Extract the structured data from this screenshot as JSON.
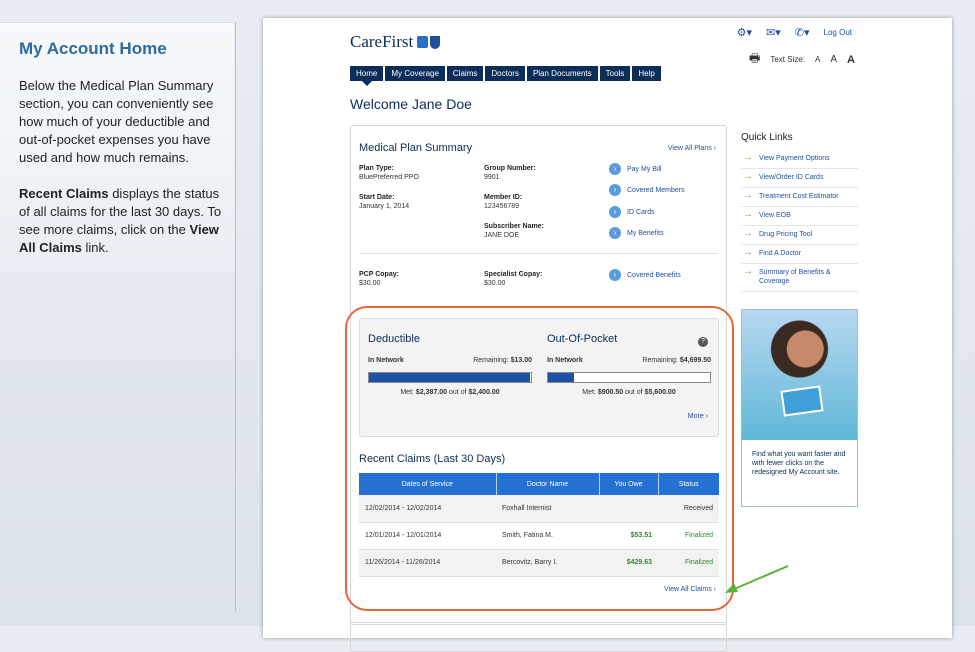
{
  "sidebar": {
    "title": "My Account Home",
    "para1": "Below the Medical Plan Summary section, you can conveniently see how much of your deductible and out-of-pocket expenses you have used and how much remains.",
    "para2_bold": "Recent Claims",
    "para2_a": " displays the status of all claims for the last 30 days. To see more claims, click on the ",
    "para2_bold2": "View All Claims",
    "para2_b": " link."
  },
  "header": {
    "logo": "CareFirst",
    "logout": "Log Out",
    "text_size_label": "Text Size:",
    "text_sizes": [
      "A",
      "A",
      "A"
    ]
  },
  "nav": [
    "Home",
    "My Coverage",
    "Claims",
    "Doctors",
    "Plan Documents",
    "Tools",
    "Help"
  ],
  "welcome": "Welcome  Jane Doe",
  "summary": {
    "title": "Medical Plan Summary",
    "view_all_plans": "View All Plans",
    "plan_type_label": "Plan Type:",
    "plan_type": "BluePreferred PPO",
    "group_label": "Group Number:",
    "group": "9901",
    "start_label": "Start Date:",
    "start": "January 1, 2014",
    "member_label": "Member ID:",
    "member": "123456789",
    "subscriber_label": "Subscriber Name:",
    "subscriber": "JANE DOE",
    "pcp_label": "PCP Copay:",
    "pcp": "$30.00",
    "specialist_label": "Specialist Copay:",
    "specialist": "$30.00",
    "links": [
      "Pay My Bill",
      "Covered Members",
      "ID Cards",
      "My Benefits",
      "Covered Benefits"
    ]
  },
  "costs": {
    "deductible_title": "Deductible",
    "oop_title": "Out-Of-Pocket",
    "in_network": "In Network",
    "ded_remaining_label": "Remaining:",
    "ded_remaining": "$13.00",
    "oop_remaining_label": "Remaining:",
    "oop_remaining": "$4,699.50",
    "ded_met_label": "Met:",
    "ded_met": "$2,387.00",
    "ded_out_of": "out of",
    "ded_total": "$2,400.00",
    "oop_met_label": "Met:",
    "oop_met": "$900.50",
    "oop_out_of": "out of",
    "oop_total": "$5,600.00",
    "ded_fill_pct": 99.5,
    "oop_fill_pct": 16.1,
    "more": "More",
    "help": "?"
  },
  "claims": {
    "title": "Recent Claims (Last 30 Days)",
    "headers": [
      "Dates of Service",
      "Doctor Name",
      "You Owe",
      "Status"
    ],
    "rows": [
      [
        "12/02/2014 - 12/02/2014",
        "Foxhall Internist",
        "",
        "Received"
      ],
      [
        "12/01/2014 - 12/01/2014",
        "Smith, Fatina M.",
        "$53.51",
        "Finalized"
      ],
      [
        "11/26/2014 - 11/26/2014",
        "Bercovitz, Barry I.",
        "$429.63",
        "Finalized"
      ]
    ],
    "view_all": "View All Claims"
  },
  "quick_links": {
    "title": "Quick Links",
    "items": [
      "View Payment Options",
      "View/Order ID Cards",
      "Treatment Cost Estimator",
      "View EOB",
      "Drug Pricing Tool",
      "Find A Doctor",
      "Summary of Benefits & Coverage"
    ]
  },
  "promo": {
    "text": "Find what you want faster and with fewer clicks on the redesigned My Account site."
  },
  "colors": {
    "accent": "#0b2d5a",
    "highlight": "#e06a3a",
    "arrow": "#5bb33a",
    "table_header": "#2471d1"
  }
}
